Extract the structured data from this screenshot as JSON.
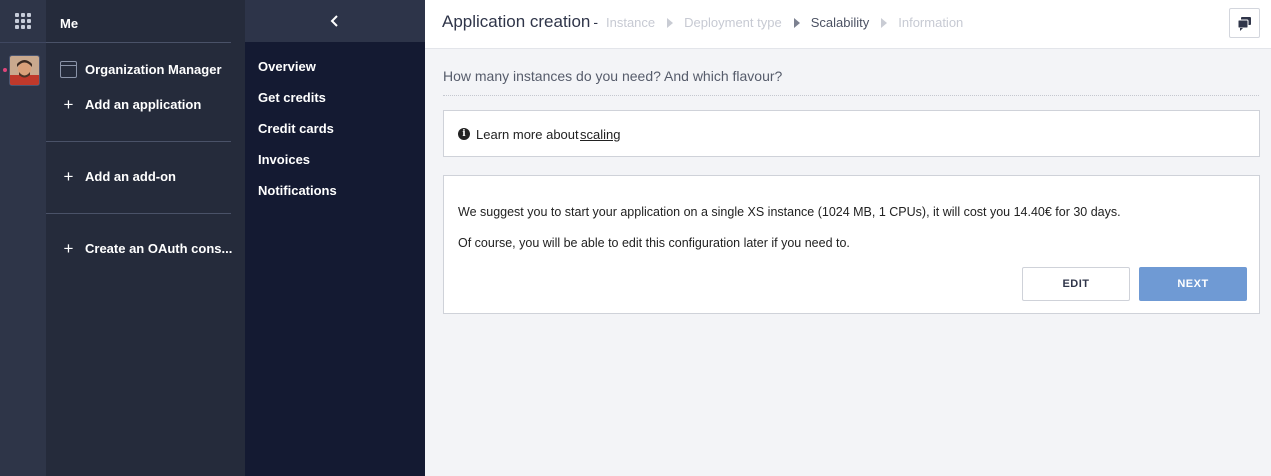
{
  "org_panel": {
    "title": "Me",
    "items": [
      {
        "label": "Organization Manager",
        "icon": "calendar-icon"
      },
      {
        "label": "Add an application",
        "icon": "plus-icon"
      },
      {
        "label": "Add an add-on",
        "icon": "plus-icon"
      },
      {
        "label": "Create an OAuth cons...",
        "icon": "plus-icon"
      }
    ]
  },
  "menu": {
    "collapse_icon": "chevron-left-icon",
    "items": [
      "Overview",
      "Get credits",
      "Credit cards",
      "Invoices",
      "Notifications"
    ]
  },
  "header": {
    "title": "Application creation",
    "separator": "-",
    "steps": [
      "Instance",
      "Deployment type",
      "Scalability",
      "Information"
    ],
    "active_step": "Scalability",
    "chat_icon": "chat-icon"
  },
  "main": {
    "question": "How many instances do you need? And which flavour?",
    "learn_prefix": "Learn more about",
    "learn_link": "scaling",
    "suggestion": "We suggest you to start your application on a single XS instance (1024 MB, 1 CPUs), it will cost you 14.40€ for 30 days.",
    "note": "Of course, you will be able to edit this configuration later if you need to.",
    "edit_label": "EDIT",
    "next_label": "NEXT"
  },
  "colors": {
    "rail": "#2e3548",
    "org_panel": "#252b3b",
    "menu": "#141a32",
    "primary_button": "#6f9ad4"
  }
}
